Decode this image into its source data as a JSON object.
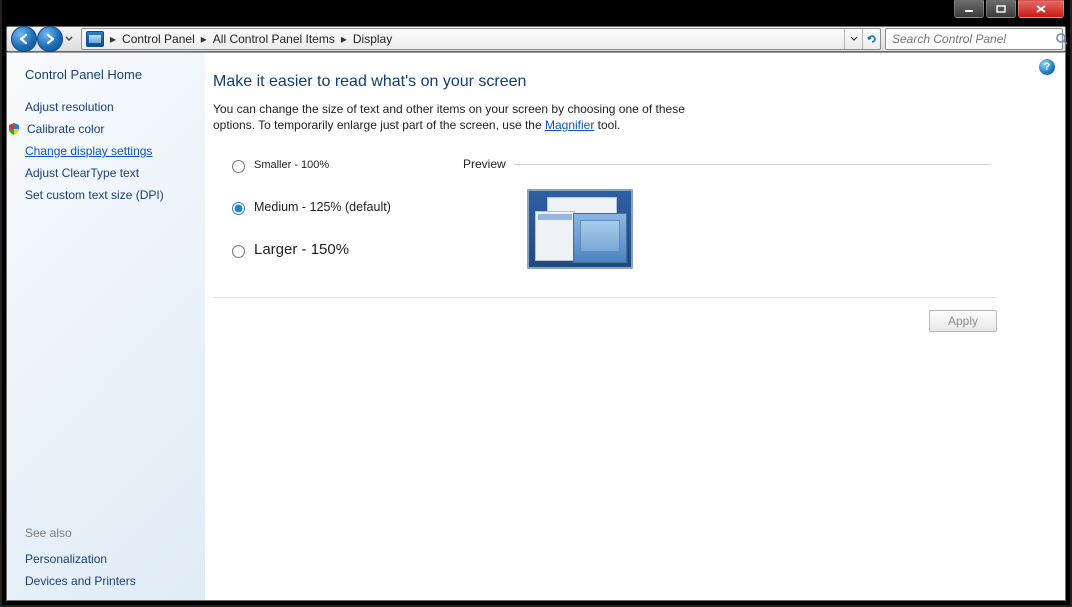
{
  "window": {
    "min": "minimize",
    "max": "maximize",
    "close": "close"
  },
  "breadcrumb": {
    "items": [
      "Control Panel",
      "All Control Panel Items",
      "Display"
    ]
  },
  "search": {
    "placeholder": "Search Control Panel"
  },
  "sidebar": {
    "home": "Control Panel Home",
    "links": [
      {
        "label": "Adjust resolution",
        "style": "normal",
        "shield": false
      },
      {
        "label": "Calibrate color",
        "style": "normal",
        "shield": true
      },
      {
        "label": "Change display settings",
        "style": "link",
        "shield": false
      },
      {
        "label": "Adjust ClearType text",
        "style": "normal",
        "shield": false
      },
      {
        "label": "Set custom text size (DPI)",
        "style": "normal",
        "shield": false
      }
    ],
    "see_also_label": "See also",
    "see_also": [
      "Personalization",
      "Devices and Printers"
    ]
  },
  "main": {
    "heading": "Make it easier to read what's on your screen",
    "desc_before": "You can change the size of text and other items on your screen by choosing one of these options. To temporarily enlarge just part of the screen, use the ",
    "desc_link": "Magnifier",
    "desc_after": " tool.",
    "options": {
      "smaller": "Smaller - 100%",
      "medium": "Medium - 125% (default)",
      "larger": "Larger - 150%",
      "selected": "medium"
    },
    "preview_label": "Preview",
    "apply_label": "Apply"
  }
}
